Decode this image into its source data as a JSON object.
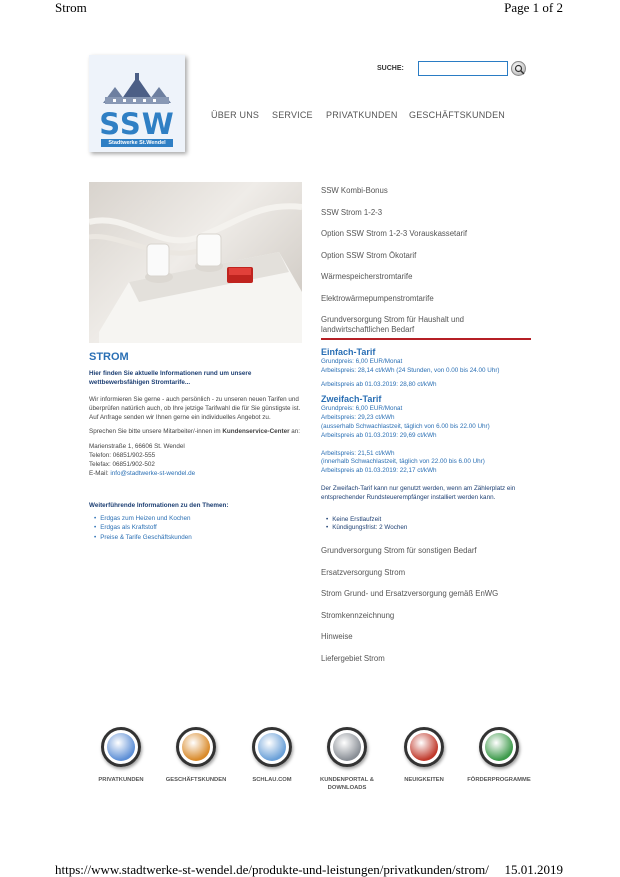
{
  "print": {
    "title": "Strom",
    "page": "Page 1 of 2",
    "url": "https://www.stadtwerke-st-wendel.de/produkte-und-leistungen/privatkunden/strom/",
    "date": "15.01.2019"
  },
  "logo": {
    "text": "SSW",
    "subtitle": "Stadtwerke St.Wendel"
  },
  "search": {
    "label": "SUCHE:",
    "value": ""
  },
  "nav": [
    "ÜBER UNS",
    "SERVICE",
    "PRIVATKUNDEN",
    "GESCHÄFTSKUNDEN"
  ],
  "left": {
    "title": "STROM",
    "intro": "Hier finden Sie aktuelle Informationen rund um unsere wettbewerbsfähigen Stromtarife...",
    "p1": "Wir informieren Sie gerne - auch persönlich - zu unseren neuen Tarifen und überprüfen natürlich auch, ob Ihre jetzige Tarifwahl die für Sie günstigste ist. Auf Anfrage senden wir Ihnen gerne ein individuelles Angebot zu.",
    "p2_a": "Sprechen Sie bitte unsere Mitarbeiter/-innen im ",
    "p2_b": "Kundenservice-Center",
    "p2_c": " an:",
    "address": "Marienstraße 1, 66606 St. Wendel",
    "phone": "Telefon: 06851/902-555",
    "fax": "Telefax: 06851/902-502",
    "email_label": "E-Mail: ",
    "email": "info@stadtwerke-st-wendel.de",
    "more_title": "Weiterführende Informationen zu den Themen:",
    "links": [
      "Erdgas zum Heizen und Kochen",
      "Erdgas als Kraftstoff",
      "Preise & Tarife Geschäftskunden"
    ]
  },
  "accordion_top": [
    "SSW Kombi-Bonus",
    "SSW Strom 1-2-3",
    "Option SSW Strom 1-2-3 Vorauskassetarif",
    "Option SSW Strom Ökotarif",
    "Wärmespeicherstromtarife",
    "Elektrowärmepumpenstromtarife"
  ],
  "accordion_open": "Grundversorgung Strom für Haushalt und landwirtschaftlichen Bedarf",
  "detail": {
    "t1": "Einfach-Tarif",
    "t1_lines": [
      "Grundpreis: 6,00 EUR/Monat",
      "Arbeitspreis: 28,14 ct/kWh (24 Stunden, von 0.00 bis 24.00 Uhr)"
    ],
    "t1_new": "Arbeitspreis ab 01.03.2019: 28,80 ct/kWh",
    "t2": "Zweifach-Tarif",
    "t2_lines": [
      "Grundpreis: 6,00 EUR/Monat",
      "Arbeitspreis: 29,23 ct/kWh",
      "(ausserhalb Schwachlastzeit, täglich von 6.00 bis 22.00 Uhr)",
      "Arbeitspreis ab 01.03.2019: 29,69 ct/kWh"
    ],
    "t2_lines_b": [
      "Arbeitspreis: 21,51 ct/kWh",
      "(innerhalb Schwachlastzeit, täglich von 22.00 bis 6.00 Uhr)",
      "Arbeitspreis ab 01.03.2019: 22,17 ct/kWh"
    ],
    "note": "Der Zweifach-Tarif kann nur genutzt werden, wenn am Zählerplatz ein entsprechender Rundsteuerempfänger installiert werden kann.",
    "bullets": [
      "Keine Erstlaufzeit",
      "Kündigungsfrist: 2 Wochen"
    ]
  },
  "accordion_bottom": [
    "Grundversorgung Strom für sonstigen Bedarf",
    "Ersatzversorgung Strom",
    "Strom Grund- und Ersatzversorgung gemäß EnWG",
    "Stromkennzeichnung",
    "Hinweise",
    "Liefergebiet Strom"
  ],
  "bottom_icons": [
    {
      "label": "PRIVATKUNDEN",
      "color": "#5d8fd6"
    },
    {
      "label": "GESCHÄFTSKUNDEN",
      "color": "#d98a2a"
    },
    {
      "label": "SCHLAU.COM",
      "color": "#6aa0d8"
    },
    {
      "label": "KUNDENPORTAL & DOWNLOADS",
      "color": "#8a8f96"
    },
    {
      "label": "NEUIGKEITEN",
      "color": "#c0392b"
    },
    {
      "label": "FÖRDERPROGRAMME",
      "color": "#3d9a4a"
    }
  ]
}
